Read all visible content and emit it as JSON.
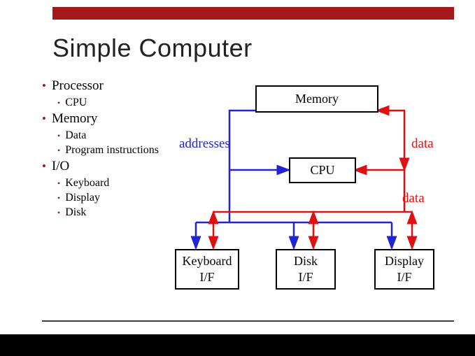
{
  "title": "Simple Computer",
  "bullets": {
    "processor": "Processor",
    "cpu": "CPU",
    "memory": "Memory",
    "data": "Data",
    "prog": "Program instructions",
    "io": "I/O",
    "keyboard": "Keyboard",
    "display": "Display",
    "disk": "Disk"
  },
  "boxes": {
    "memory": "Memory",
    "cpu": "CPU",
    "kb_if_l1": "Keyboard",
    "kb_if_l2": "I/F",
    "disk_if_l1": "Disk",
    "disk_if_l2": "I/F",
    "disp_if_l1": "Display",
    "disp_if_l2": "I/F"
  },
  "labels": {
    "addresses": "addresses",
    "data1": "data",
    "data2": "data"
  },
  "colors": {
    "accent": "#A31919",
    "address": "#2323d6",
    "data": "#e01010"
  }
}
